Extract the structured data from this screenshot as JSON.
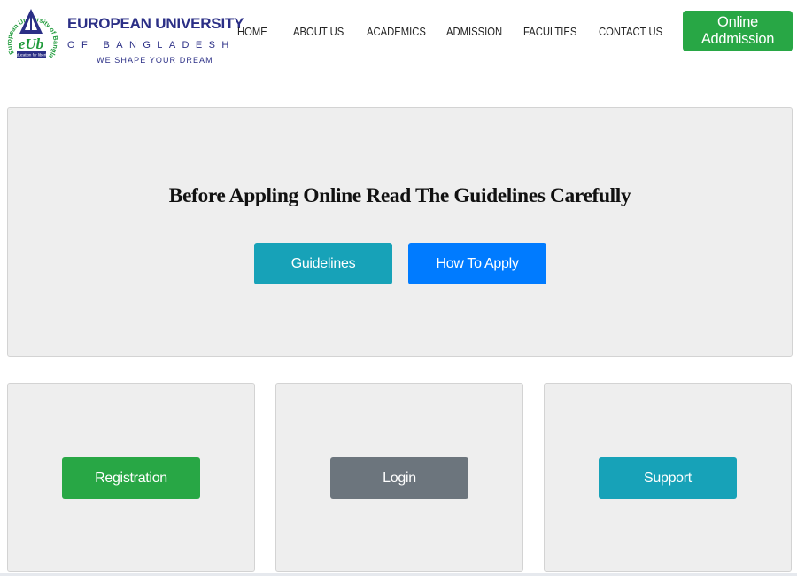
{
  "brand": {
    "arc_text": "European University of Bangladesh",
    "logo_initials": "eUb",
    "logo_motto": "education for liberty",
    "name": "EUROPEAN UNIVERSITY",
    "country": "OF BANGLADESH",
    "tagline": "WE SHAPE YOUR DREAM",
    "primary_color": "#2b2f86",
    "accent_color": "#1e9a3a"
  },
  "nav": {
    "items": [
      {
        "label": "HOME"
      },
      {
        "label": "ABOUT US"
      },
      {
        "label": "ACADEMICS"
      },
      {
        "label": "ADMISSION"
      },
      {
        "label": "FACULTIES"
      },
      {
        "label": "CONTACT US"
      }
    ],
    "cta_label": "Online Addmission",
    "cta_color": "#28a745"
  },
  "hero": {
    "title": "Before Appling Online Read The Guidelines Carefully",
    "guidelines_label": "Guidelines",
    "how_to_apply_label": "How To Apply"
  },
  "cards": [
    {
      "button_label": "Registration",
      "color": "#28a745"
    },
    {
      "button_label": "Login",
      "color": "#6c757d"
    },
    {
      "button_label": "Support",
      "color": "#17a2b8"
    }
  ]
}
